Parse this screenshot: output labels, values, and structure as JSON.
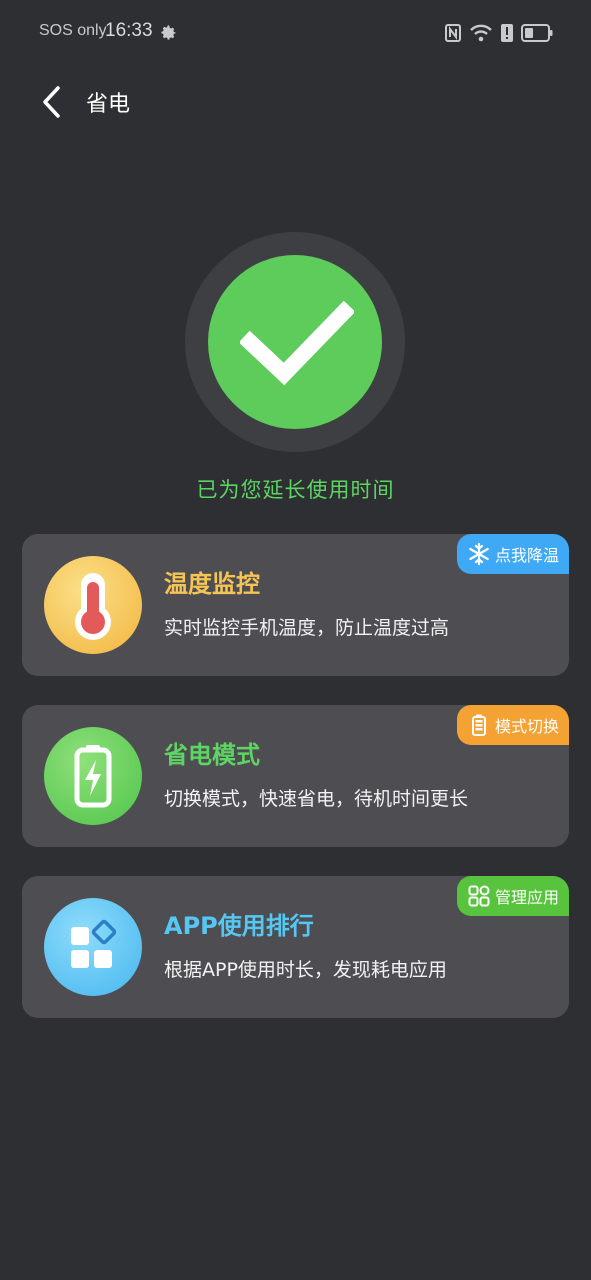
{
  "status_bar": {
    "carrier": "SOS only",
    "time": "16:33"
  },
  "header": {
    "title": "省电"
  },
  "hero": {
    "message": "已为您延长使用时间"
  },
  "cards": [
    {
      "title": "温度监控",
      "description": "实时监控手机温度，防止温度过高",
      "badge": "点我降温",
      "title_color": "#f6c453",
      "badge_color": "#3fa9f5"
    },
    {
      "title": "省电模式",
      "description": "切换模式，快速省电，待机时间更长",
      "badge": "模式切换",
      "title_color": "#5ed463",
      "badge_color": "#f5a234"
    },
    {
      "title": "APP使用排行",
      "description": "根据APP使用时长，发现耗电应用",
      "badge": "管理应用",
      "title_color": "#56c6f2",
      "badge_color": "#58c43e"
    }
  ]
}
